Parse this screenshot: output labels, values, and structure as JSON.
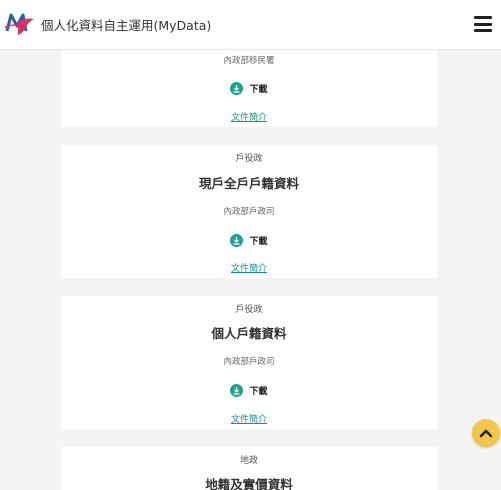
{
  "header": {
    "title": "個人化資料自主運用(MyData)",
    "menu_icon": "hamburger-menu-icon"
  },
  "cards": [
    {
      "category": "",
      "title": "",
      "agency": "內政部移民署",
      "download_label": "下載",
      "doc_link": "文件簡介"
    },
    {
      "category": "戶役政",
      "title": "現戶全戶戶籍資料",
      "agency": "內政部戶政司",
      "download_label": "下載",
      "doc_link": "文件簡介"
    },
    {
      "category": "戶役政",
      "title": "個人戶籍資料",
      "agency": "內政部戶政司",
      "download_label": "下載",
      "doc_link": "文件簡介"
    },
    {
      "category": "地政",
      "title": "地籍及實價資料",
      "agency": "",
      "download_label": "",
      "doc_link": ""
    }
  ],
  "colors": {
    "accent": "#1aa28f",
    "scroll_top": "#f2c84b",
    "background": "#f4f4f4"
  },
  "scroll_top_icon": "chevron-up-icon"
}
